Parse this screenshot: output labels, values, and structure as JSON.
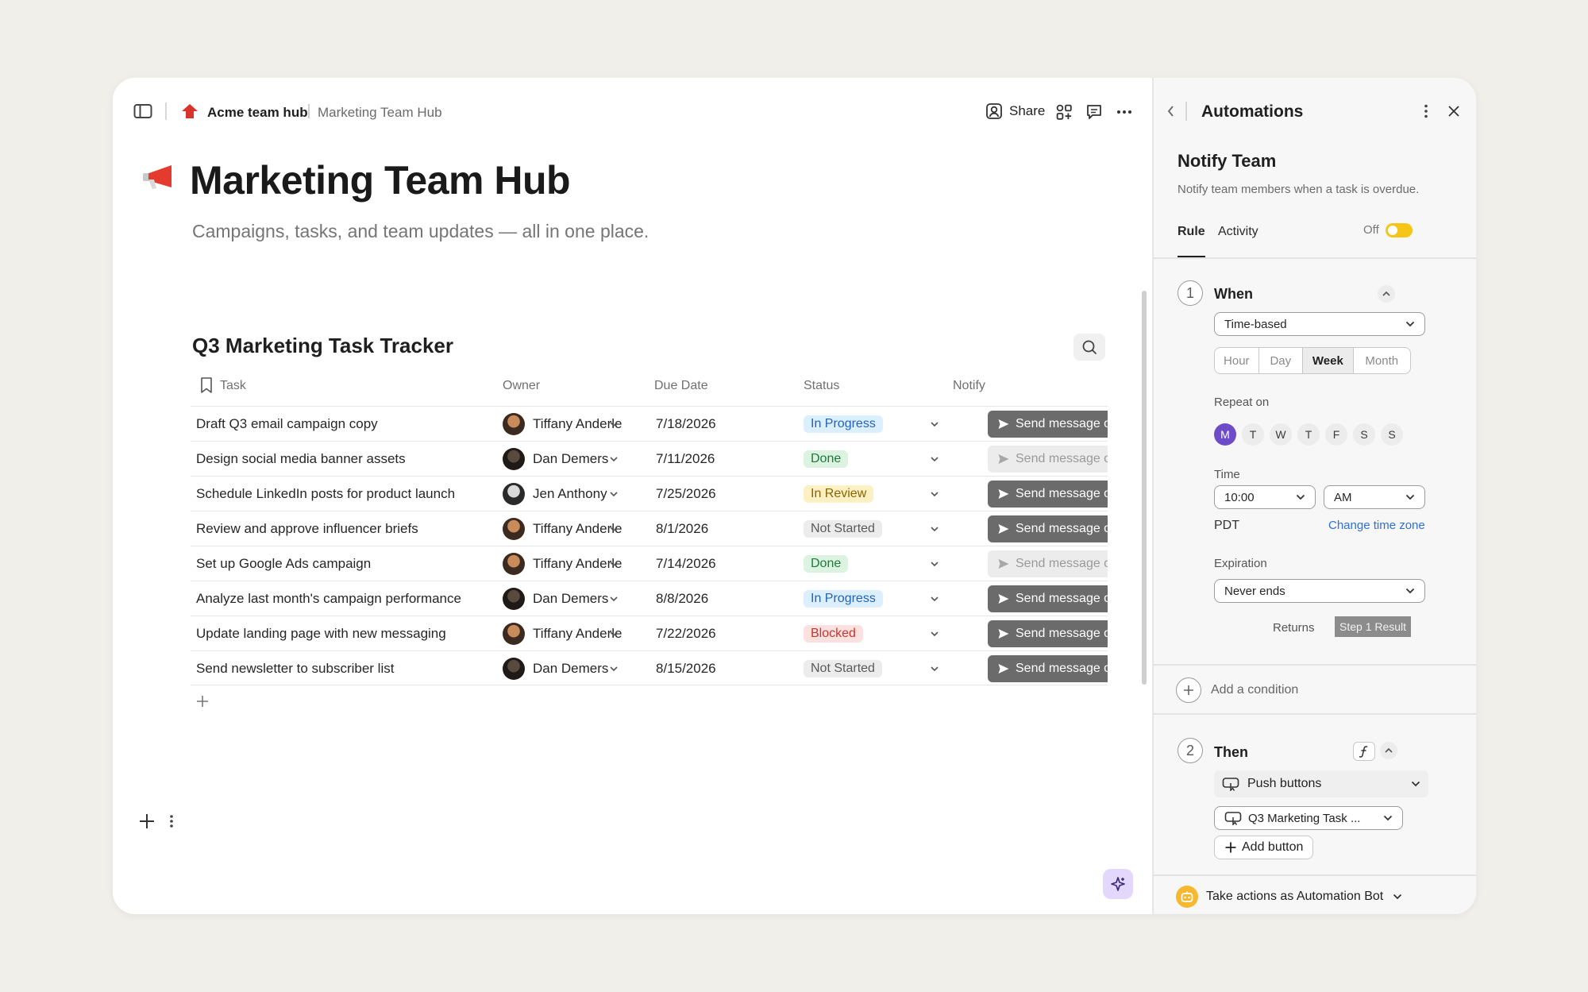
{
  "topbar": {
    "doc_name": "Acme team hub",
    "page_name": "Marketing Team Hub",
    "share_label": "Share"
  },
  "page": {
    "title": "Marketing Team Hub",
    "subtitle": "Campaigns, tasks, and team updates — all in one place."
  },
  "table": {
    "title": "Q3 Marketing Task Tracker",
    "columns": [
      "Task",
      "Owner",
      "Due Date",
      "Status",
      "Notify"
    ],
    "rows": [
      {
        "task": "Draft Q3 email campaign copy",
        "owner": "Tiffany Anderle",
        "due": "7/18/2026",
        "status": "In Progress",
        "notify": "Send message or not",
        "notify_enabled": true
      },
      {
        "task": "Design social media banner assets",
        "owner": "Dan Demers",
        "due": "7/11/2026",
        "status": "Done",
        "notify": "Send message or not",
        "notify_enabled": false
      },
      {
        "task": "Schedule LinkedIn posts for product launch",
        "owner": "Jen Anthony",
        "due": "7/25/2026",
        "status": "In Review",
        "notify": "Send message or not",
        "notify_enabled": true
      },
      {
        "task": "Review and approve influencer briefs",
        "owner": "Tiffany Anderle",
        "due": "8/1/2026",
        "status": "Not Started",
        "notify": "Send message or not",
        "notify_enabled": true
      },
      {
        "task": "Set up Google Ads campaign",
        "owner": "Tiffany Anderle",
        "due": "7/14/2026",
        "status": "Done",
        "notify": "Send message or not",
        "notify_enabled": false
      },
      {
        "task": "Analyze last month's campaign performance",
        "owner": "Dan Demers",
        "due": "8/8/2026",
        "status": "In Progress",
        "notify": "Send message or not",
        "notify_enabled": true
      },
      {
        "task": "Update landing page with new messaging",
        "owner": "Tiffany Anderle",
        "due": "7/22/2026",
        "status": "Blocked",
        "notify": "Send message or not",
        "notify_enabled": true
      },
      {
        "task": "Send newsletter to subscriber list",
        "owner": "Dan Demers",
        "due": "8/15/2026",
        "status": "Not Started",
        "notify": "Send message or not",
        "notify_enabled": true
      }
    ]
  },
  "status_colors": {
    "In Progress": {
      "bg": "#dcefff",
      "fg": "#2364b8"
    },
    "Done": {
      "bg": "#dcf3e1",
      "fg": "#1f7a3a"
    },
    "In Review": {
      "bg": "#fdf1c4",
      "fg": "#8a6400"
    },
    "Not Started": {
      "bg": "#ececec",
      "fg": "#5a5a5a"
    },
    "Blocked": {
      "bg": "#fde0e0",
      "fg": "#c0392b"
    }
  },
  "panel": {
    "title": "Automations",
    "rule_name": "Notify Team",
    "rule_desc": "Notify team members when a task is overdue.",
    "tabs": [
      "Rule",
      "Activity"
    ],
    "toggle_label": "Off",
    "step1": {
      "number": "1",
      "label": "When",
      "trigger": "Time-based",
      "intervals": [
        "Hour",
        "Day",
        "Week",
        "Month"
      ],
      "selected_interval": "Week",
      "repeat_label": "Repeat on",
      "days": [
        "M",
        "T",
        "W",
        "T",
        "F",
        "S",
        "S"
      ],
      "time_label": "Time",
      "time_value": "10:00",
      "ampm_value": "AM",
      "timezone": "PDT",
      "change_tz": "Change time zone",
      "expiration_label": "Expiration",
      "expiration_value": "Never ends",
      "returns_label": "Returns",
      "returns_value": "Step 1 Result"
    },
    "add_condition": "Add a condition",
    "step2": {
      "number": "2",
      "label": "Then",
      "action": "Push buttons",
      "target": "Q3 Marketing Task ...",
      "add_button": "Add button"
    },
    "bot_label": "Take actions as Automation Bot"
  },
  "accent": "#6e4bc9",
  "toggle_color": "#f5c518"
}
